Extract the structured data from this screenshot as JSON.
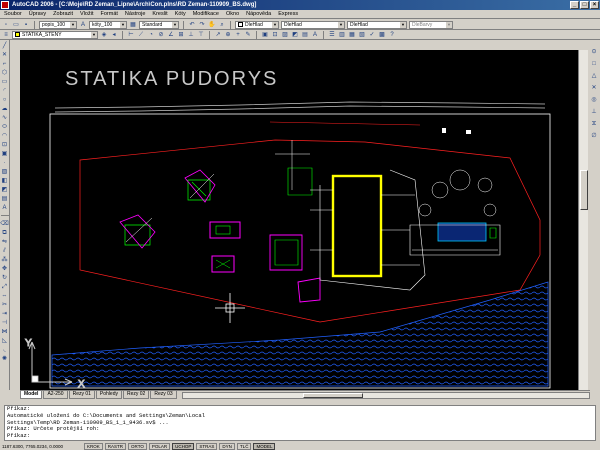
{
  "window": {
    "title": "AutoCAD 2006 - [C:\\Moje\\RD Zeman_Lipne\\Arch\\Con.plns\\RD Zeman-110909_BS.dwg]",
    "minimize": "_",
    "maximize": "□",
    "close": "×"
  },
  "menu": [
    "Soubor",
    "Úpravy",
    "Zobrazit",
    "Vložit",
    "Formát",
    "Nástroje",
    "Kreslit",
    "Kóty",
    "Modifikace",
    "Okno",
    "Nápověda",
    "Express"
  ],
  "toolbar_props": {
    "layer_dropdown": "popis_100",
    "style_dropdown": "kóty_100",
    "dimstyle_dropdown": "Standard",
    "color_dropdown": "DleHlad",
    "linetype_dropdown": "DleHlad",
    "lineweight_dropdown": "DleHlad",
    "plotstyle_dropdown": "DleBarvy",
    "current_layer": "STATIKA_STENY"
  },
  "drawing": {
    "title": "STATIKA PUDORYS",
    "ucs_x": "X",
    "ucs_y": "Y",
    "colors": {
      "background": "#000000",
      "text": "#c8c8c8",
      "border": "#ffffff",
      "walls": "#ffff00",
      "magenta": "#ff00ff",
      "green": "#00ff00",
      "cyan": "#00c8ff",
      "red": "#ff2020",
      "water": "#2060ff"
    }
  },
  "tabs": [
    "Model",
    "A2-250",
    "Rezy 01",
    "Pohledy",
    "Rezy 02",
    "Rezy 03"
  ],
  "command_window": {
    "lines": [
      "Příkaz:",
      "Automatické uložení do C:\\Documents and Settings\\Zeman\\Local",
      "Settings\\Temp\\RD Zeman-110909_BS_1_1_9436.sv$ ...",
      "Příkaz: Určete protější roh:",
      "",
      "Příkaz:"
    ]
  },
  "status": {
    "coords": "1187.6300, 7765.0234, 0.0000",
    "buttons": [
      "KROK",
      "RASTR",
      "ORTO",
      "POLAR",
      "UCHOP",
      "STRAS",
      "DYN",
      "TLČ",
      "MODEL"
    ],
    "active": [
      "UCHOP",
      "MODEL"
    ]
  }
}
